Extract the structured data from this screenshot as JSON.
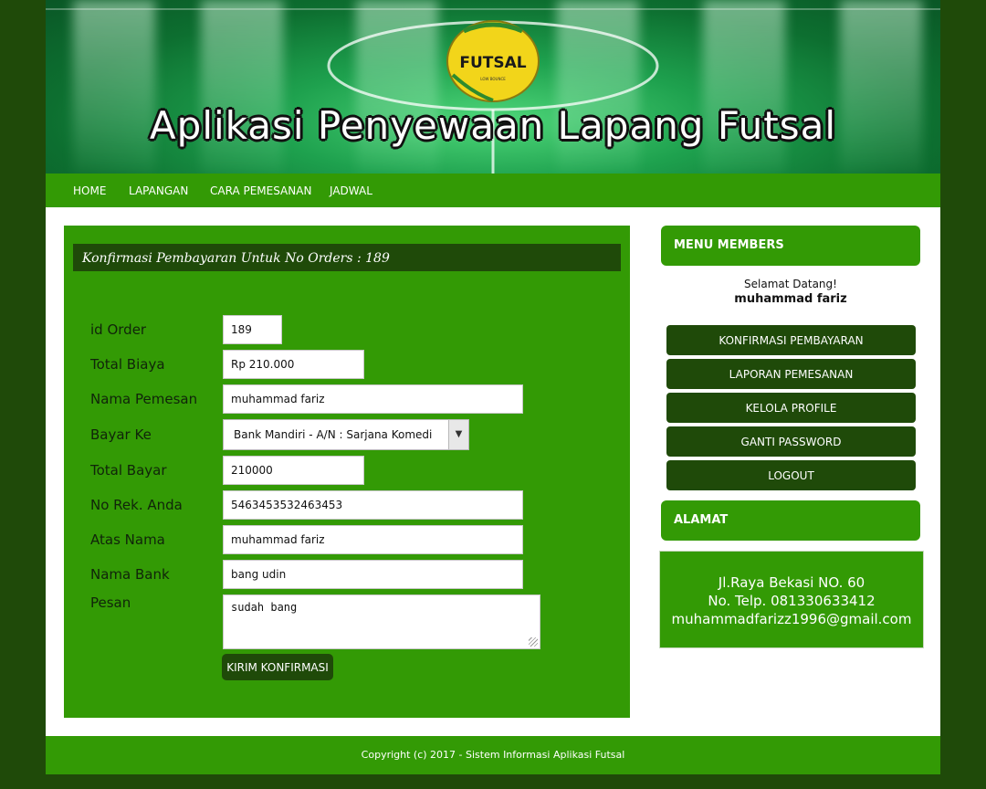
{
  "header": {
    "title": "Aplikasi Penyewaan Lapang Futsal",
    "ball_text": "FUTSAL",
    "ball_small_text": "LOW BOUNCE"
  },
  "nav": {
    "items": [
      "HOME",
      "LAPANGAN",
      "CARA PEMESANAN",
      "JADWAL"
    ]
  },
  "form": {
    "heading": "Konfirmasi Pembayaran Untuk No Orders : 189",
    "fields": {
      "id_order": {
        "label": "id Order",
        "value": "189"
      },
      "total_biaya": {
        "label": "Total Biaya",
        "value": "Rp 210.000"
      },
      "nama_pemesan": {
        "label": "Nama Pemesan",
        "value": "muhammad fariz"
      },
      "bayar_ke": {
        "label": "Bayar Ke",
        "value": "Bank Mandiri - A/N : Sarjana Komedi"
      },
      "total_bayar": {
        "label": "Total Bayar",
        "value": "210000"
      },
      "no_rek": {
        "label": "No Rek. Anda",
        "value": "5463453532463453"
      },
      "atas_nama": {
        "label": "Atas Nama",
        "value": "muhammad fariz"
      },
      "nama_bank": {
        "label": "Nama Bank",
        "value": "bang udin"
      },
      "pesan": {
        "label": "Pesan",
        "value": "sudah bang"
      }
    },
    "submit_label": "KIRIM KONFIRMASI"
  },
  "sidebar": {
    "menu_title": "MENU MEMBERS",
    "welcome": "Selamat Datang!",
    "username": "muhammad fariz",
    "menu_items": [
      "KONFIRMASI PEMBAYARAN",
      "LAPORAN PEMESANAN",
      "KELOLA PROFILE",
      "GANTI PASSWORD",
      "LOGOUT"
    ],
    "address_title": "ALAMAT",
    "address_lines": [
      "Jl.Raya Bekasi NO. 60",
      "No. Telp. 081330633412",
      "muhammadfarizz1996@gmail.com"
    ]
  },
  "footer": {
    "text": "Copyright (c) 2017 - Sistem Informasi Aplikasi Futsal"
  },
  "colors": {
    "outer_bg": "#1f4a09",
    "accent_green": "#339a05",
    "dark_green": "#1f4a09"
  }
}
